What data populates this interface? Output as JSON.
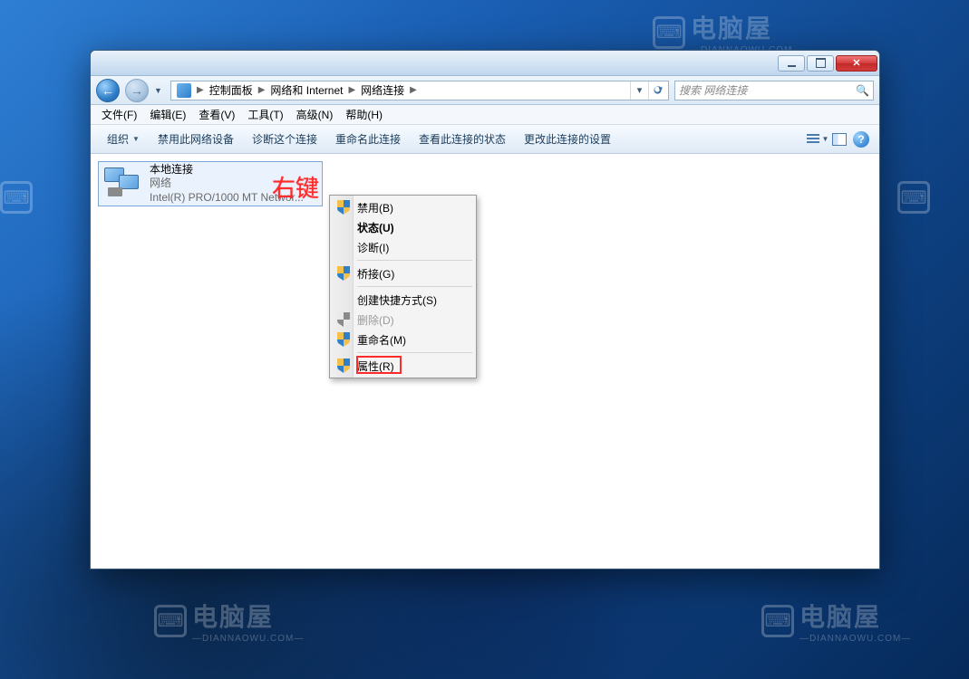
{
  "watermark": {
    "brand": "电脑屋",
    "domain": "—DIANNAOWU.COM—"
  },
  "window_controls": {
    "min": "minimize",
    "max": "maximize",
    "close": "close"
  },
  "breadcrumb": {
    "items": [
      "控制面板",
      "网络和 Internet",
      "网络连接"
    ]
  },
  "search": {
    "placeholder": "搜索 网络连接"
  },
  "menubar": {
    "items": [
      "文件(F)",
      "编辑(E)",
      "查看(V)",
      "工具(T)",
      "高级(N)",
      "帮助(H)"
    ]
  },
  "toolbar": {
    "organize": "组织",
    "actions": [
      "禁用此网络设备",
      "诊断这个连接",
      "重命名此连接",
      "查看此连接的状态",
      "更改此连接的设置"
    ]
  },
  "connection": {
    "name": "本地连接",
    "status": "网络",
    "adapter": "Intel(R) PRO/1000 MT Networ..."
  },
  "annotation": "右键",
  "context_menu": {
    "disable": "禁用(B)",
    "status": "状态(U)",
    "diagnose": "诊断(I)",
    "bridge": "桥接(G)",
    "shortcut": "创建快捷方式(S)",
    "delete": "删除(D)",
    "rename": "重命名(M)",
    "properties": "属性(R)"
  }
}
